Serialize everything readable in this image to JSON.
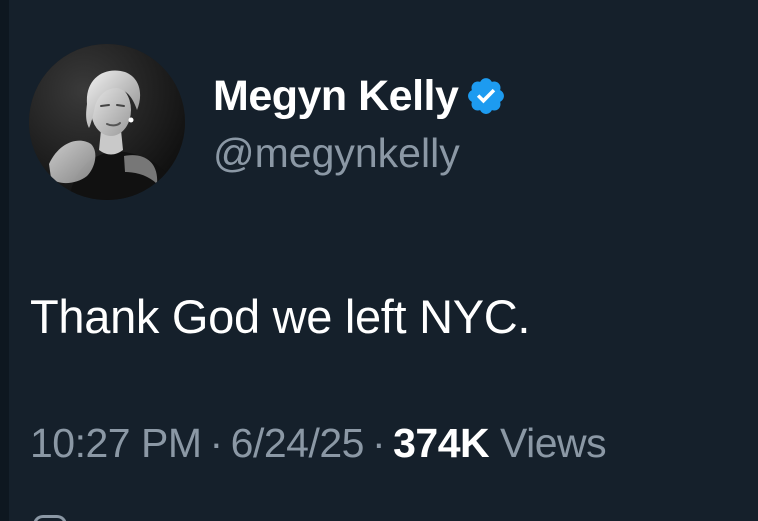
{
  "tweet": {
    "author": {
      "display_name": "Megyn Kelly",
      "handle": "@megynkelly",
      "verified": true,
      "verified_color": "#1d9bf0",
      "avatar": "profile-photo"
    },
    "text": "Thank God we left NYC.",
    "meta": {
      "time": "10:27 PM",
      "separator": "·",
      "date": "6/24/25",
      "views_count": "374K",
      "views_label": "Views"
    }
  },
  "theme": {
    "background": "#15202b",
    "primary_text": "#ffffff",
    "secondary_text": "#8b98a5"
  }
}
